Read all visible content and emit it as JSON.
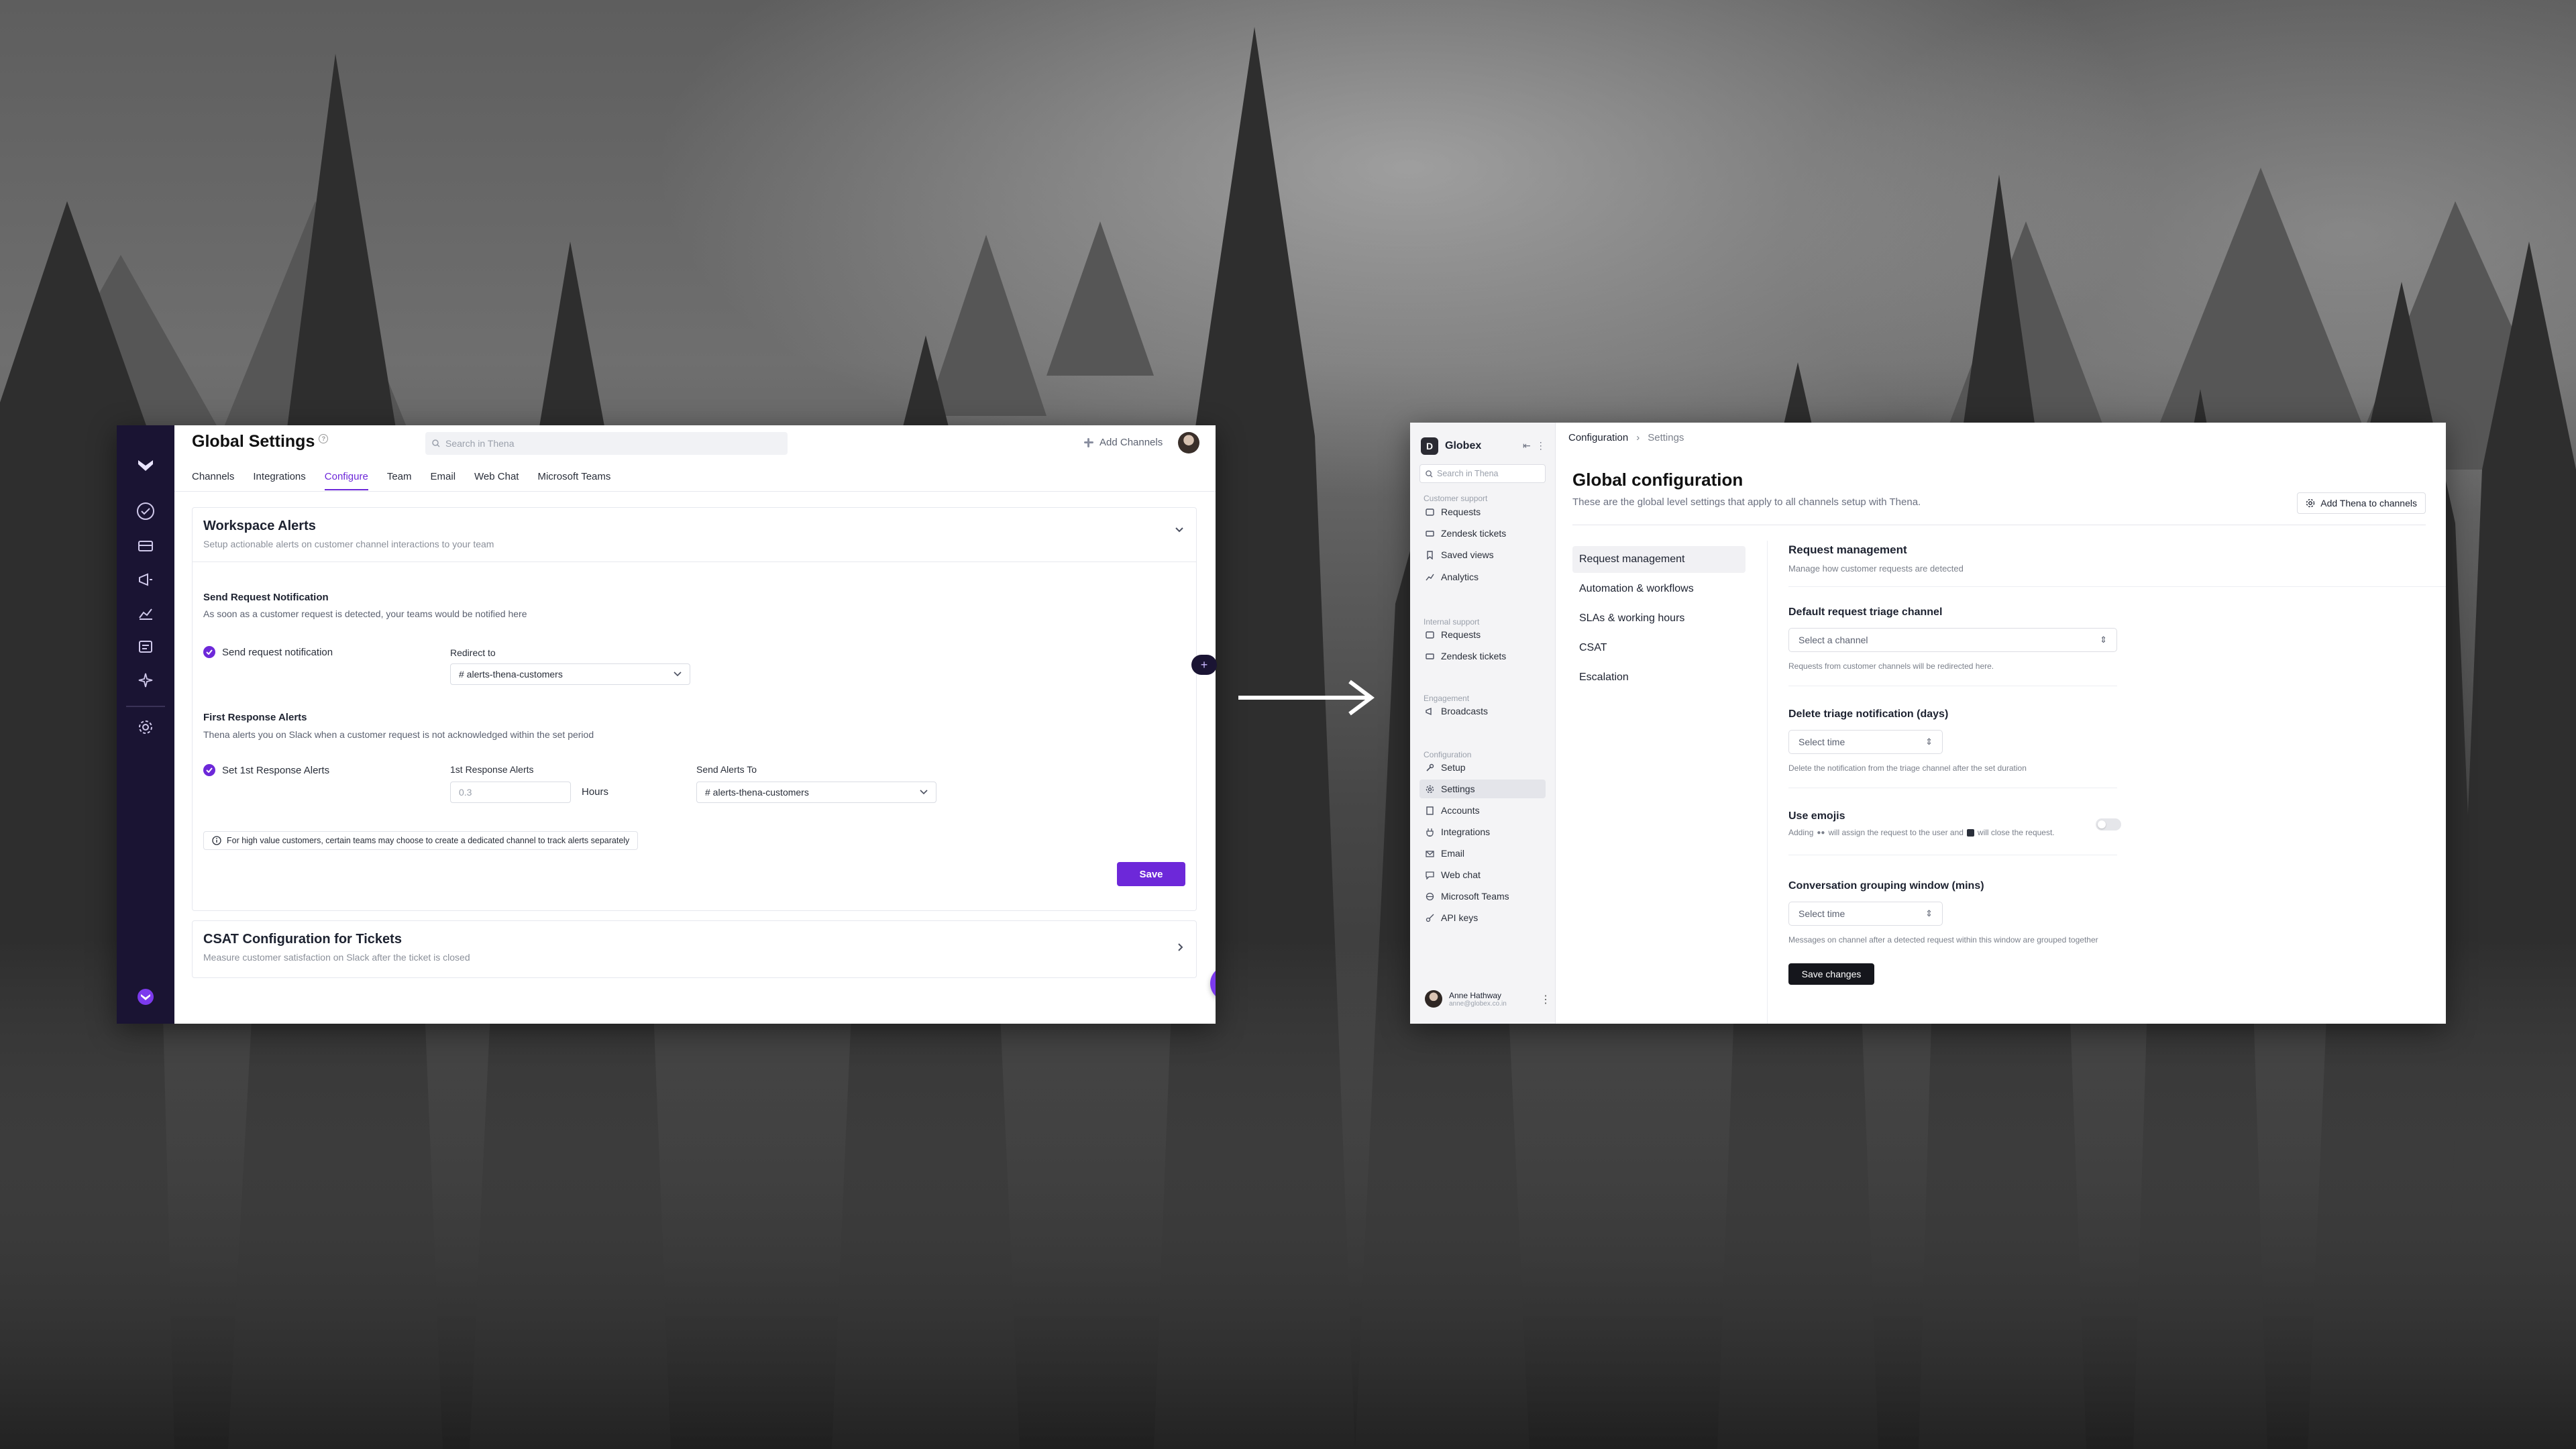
{
  "left": {
    "title": "Global Settings",
    "search_placeholder": "Search in Thena",
    "add_channels": "Add Channels",
    "tabs": [
      "Channels",
      "Integrations",
      "Configure",
      "Team",
      "Email",
      "Web Chat",
      "Microsoft Teams"
    ],
    "active_tab": "Configure",
    "workspace_alerts": {
      "title": "Workspace Alerts",
      "subtitle": "Setup actionable alerts on customer channel interactions to your team"
    },
    "send_request": {
      "title": "Send Request Notification",
      "subtitle": "As soon as a customer request is detected, your teams would be notified here",
      "checkbox_label": "Send request notification",
      "redirect_label": "Redirect to",
      "redirect_value": "# alerts-thena-customers"
    },
    "first_response": {
      "title": "First Response Alerts",
      "subtitle": "Thena alerts you on Slack when a customer request is not acknowledged within the set period",
      "checkbox_label": "Set 1st Response Alerts",
      "alerts_label": "1st Response Alerts",
      "alerts_value": "0.3",
      "hours_label": "Hours",
      "send_to_label": "Send Alerts To",
      "send_to_value": "# alerts-thena-customers"
    },
    "note": "For high value customers, certain teams may choose to create a dedicated channel to track alerts separately",
    "save": "Save",
    "csat": {
      "title": "CSAT Configuration for Tickets",
      "subtitle": "Measure customer satisfaction on Slack after the ticket is closed"
    }
  },
  "right": {
    "org": "Globex",
    "search_placeholder": "Search in Thena",
    "groups": {
      "customer_support": "Customer support",
      "internal_support": "Internal support",
      "engagement": "Engagement",
      "configuration": "Configuration"
    },
    "customer_items": [
      "Requests",
      "Zendesk tickets",
      "Saved views",
      "Analytics"
    ],
    "internal_items": [
      "Requests",
      "Zendesk tickets"
    ],
    "engagement_items": [
      "Broadcasts"
    ],
    "config_items": [
      "Setup",
      "Settings",
      "Accounts",
      "Integrations",
      "Email",
      "Web chat",
      "Microsoft Teams",
      "API keys"
    ],
    "active_config_item": "Settings",
    "user": {
      "name": "Anne Hathway",
      "email": "anne@globex.co.in"
    },
    "breadcrumb": [
      "Configuration",
      "Settings"
    ],
    "title": "Global configuration",
    "subtitle": "These are the global level settings that apply to all channels setup with Thena.",
    "add_thena": "Add Thena to channels",
    "nav": [
      "Request management",
      "Automation & workflows",
      "SLAs & working hours",
      "CSAT",
      "Escalation"
    ],
    "active_nav": "Request management",
    "section_title": "Request management",
    "section_sub": "Manage how customer requests are detected",
    "triage": {
      "label": "Default request triage channel",
      "placeholder": "Select a channel",
      "hint": "Requests from customer channels will be redirected here."
    },
    "delete_triage": {
      "label": "Delete triage notification (days)",
      "placeholder": "Select time",
      "hint": "Delete the notification from the triage channel after the set duration"
    },
    "emojis": {
      "label": "Use emojis",
      "hint_a": "Adding",
      "hint_b": "will assign the request to the user and",
      "hint_c": "will close the request.",
      "enabled": false
    },
    "grouping": {
      "label": "Conversation grouping window (mins)",
      "placeholder": "Select time",
      "hint": "Messages on channel after a detected request within this window are grouped together"
    },
    "save_changes": "Save changes"
  },
  "icons": {
    "rail": [
      "thena-logo-icon",
      "check-circle-icon",
      "ticket-icon",
      "megaphone-icon",
      "chart-icon",
      "list-icon",
      "sparkle-icon",
      "gear-icon",
      "thena-bottom-icon"
    ]
  },
  "colors": {
    "accent": "#6d28d9",
    "rail": "#1a1433"
  }
}
